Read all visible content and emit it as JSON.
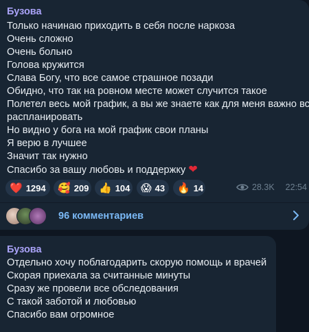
{
  "post1": {
    "author": "Бузова",
    "lines": [
      "Только начинаю приходить в себя после наркоза",
      "Очень сложно",
      "Очень больно",
      "Голова кружится",
      "Слава Богу, что все самое страшное позади",
      "Обидно, что так на ровном месте может случится такое",
      "Полетел весь мой график, а вы же знаете как для меня важно все",
      "распланировать",
      "Но видно у бога на мой график свои планы",
      "Я верю в лучшее",
      "Значит так нужно",
      "Спасибо за вашу любовь и поддержку"
    ],
    "trailing_emoji": "❤",
    "reactions": [
      {
        "emoji": "❤️",
        "icon": "heart-icon",
        "count": "1294"
      },
      {
        "emoji": "🥰",
        "icon": "smiling-face-hearts-icon",
        "count": "209"
      },
      {
        "emoji": "👍",
        "icon": "thumbs-up-icon",
        "count": "104"
      },
      {
        "emoji": "😱",
        "icon": "screaming-face-icon",
        "count": "43"
      },
      {
        "emoji": "🔥",
        "icon": "fire-icon",
        "count": "14"
      }
    ],
    "views": "28.3K",
    "time": "22:54",
    "comments_label": "96 комментариев"
  },
  "post2": {
    "author": "Бузова",
    "lines": [
      "Отдельно хочу поблагодарить скорую помощь и врачей",
      "Скорая приехала за считанные минуты",
      "Сразу же провели все обследования",
      "С такой заботой и любовью",
      "Спасибо вам огромное"
    ]
  },
  "colors": {
    "background": "#0e1621",
    "bubble": "#182533",
    "author": "#aaa3f8",
    "link": "#7ab8f5",
    "reaction_bg": "#243549"
  }
}
